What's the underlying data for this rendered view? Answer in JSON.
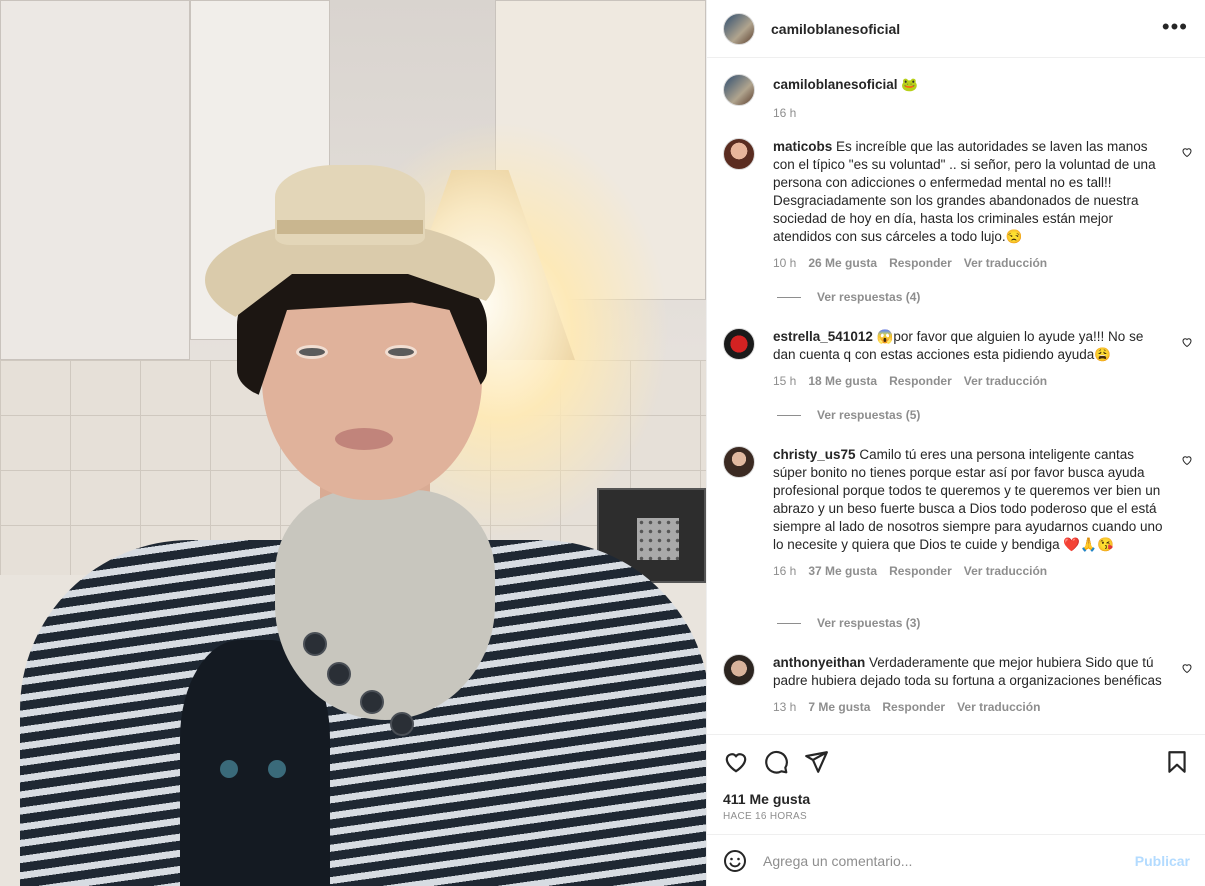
{
  "post": {
    "author": "camiloblanesoficial",
    "more_label": "•••",
    "caption_emoji": "🐸",
    "caption_time": "16 h"
  },
  "comments": [
    {
      "user": "maticobs",
      "text": "Es increíble que las autoridades se laven las manos con el típico \"es su voluntad\" .. si señor, pero la voluntad de una persona con adicciones o enfermedad mental no es tall!! Desgraciadamente son los grandes abandonados de nuestra sociedad de hoy en día, hasta los criminales están mejor atendidos con sus cárceles a todo lujo.😒",
      "time": "10 h",
      "likes": "26 Me gusta",
      "reply": "Responder",
      "translate": "Ver traducción",
      "replies": "Ver respuestas (4)"
    },
    {
      "user": "estrella_541012",
      "text": "😱por favor que alguien lo ayude ya!!! No se dan cuenta q con estas acciones esta pidiendo ayuda😩",
      "time": "15 h",
      "likes": "18 Me gusta",
      "reply": "Responder",
      "translate": "Ver traducción",
      "replies": "Ver respuestas (5)"
    },
    {
      "user": "christy_us75",
      "text": "Camilo tú eres una persona inteligente cantas súper bonito no tienes porque estar así por favor busca ayuda profesional porque todos te queremos y te queremos ver bien un abrazo y un beso fuerte busca a Dios todo poderoso que el está siempre al lado de nosotros siempre para ayudarnos cuando uno lo necesite y quiera que Dios te cuide y bendiga ❤️🙏😘",
      "time": "16 h",
      "likes": "37 Me gusta",
      "reply": "Responder",
      "translate": "Ver traducción",
      "replies": "Ver respuestas (3)"
    },
    {
      "user": "anthonyeithan",
      "text": "Verdaderamente que mejor hubiera Sido que tú padre hubiera dejado toda su fortuna a organizaciones benéficas",
      "time": "13 h",
      "likes": "7 Me gusta",
      "reply": "Responder",
      "translate": "Ver traducción"
    }
  ],
  "footer": {
    "likes": "411 Me gusta",
    "ago": "HACE 16 HORAS",
    "comment_placeholder": "Agrega un comentario...",
    "publish": "Publicar"
  },
  "icons": {
    "like": "heart-icon",
    "comment": "comment-icon",
    "share": "send-icon",
    "save": "bookmark-icon",
    "emoji": "emoji-icon",
    "more": "more-icon"
  },
  "colors": {
    "text": "#262626",
    "muted": "#8e8e8e",
    "publish_disabled": "#b3dbff",
    "border": "#efefef"
  }
}
